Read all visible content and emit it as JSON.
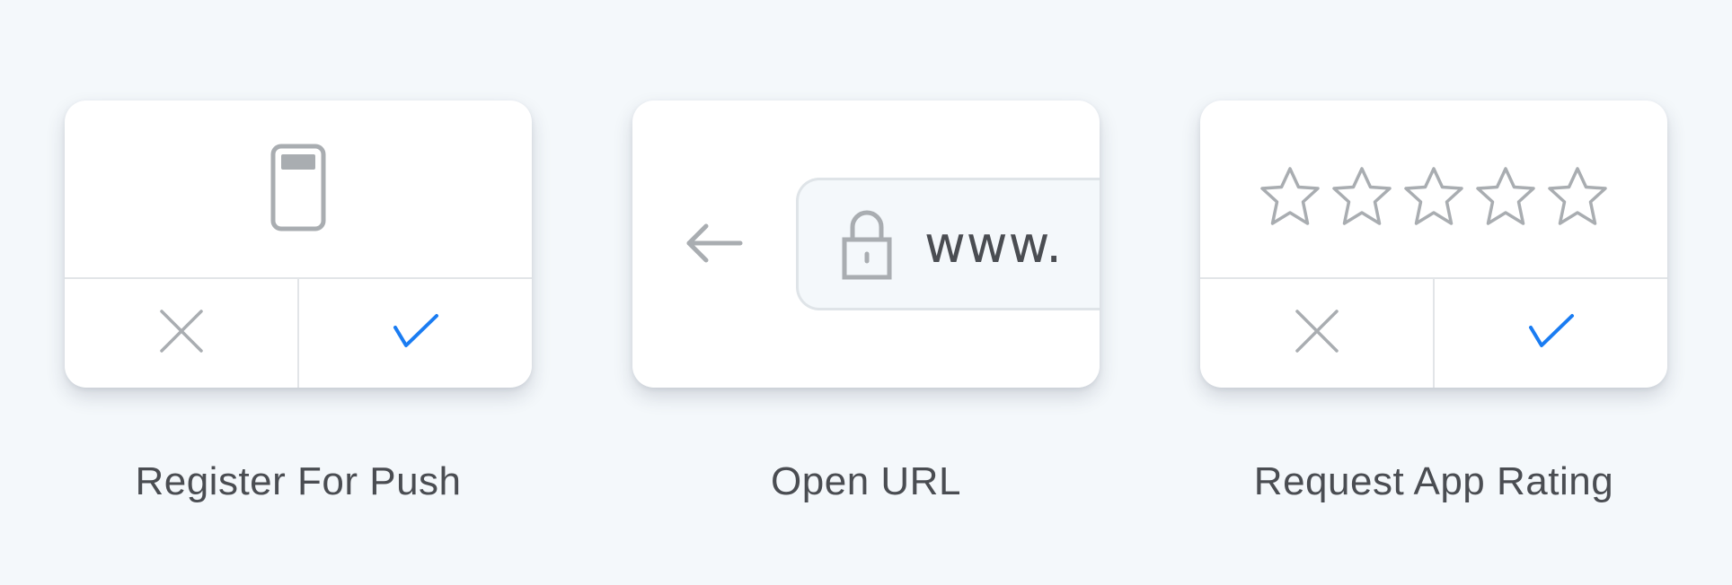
{
  "colors": {
    "background": "#f4f8fb",
    "card": "#ffffff",
    "icon_gray": "#a9adb1",
    "accent_blue": "#1a7cf2",
    "label_text": "#4a4d52"
  },
  "cards": [
    {
      "label": "Register For Push",
      "icon": "phone-icon",
      "cancel_icon": "close-icon",
      "confirm_icon": "checkmark-icon"
    },
    {
      "label": "Open URL",
      "back_icon": "back-arrow-icon",
      "lock_icon": "lock-icon",
      "url_text": "www."
    },
    {
      "label": "Request App Rating",
      "rating_max": 5,
      "rating_value": 0,
      "star_icon": "star-outline-icon",
      "cancel_icon": "close-icon",
      "confirm_icon": "checkmark-icon"
    }
  ]
}
